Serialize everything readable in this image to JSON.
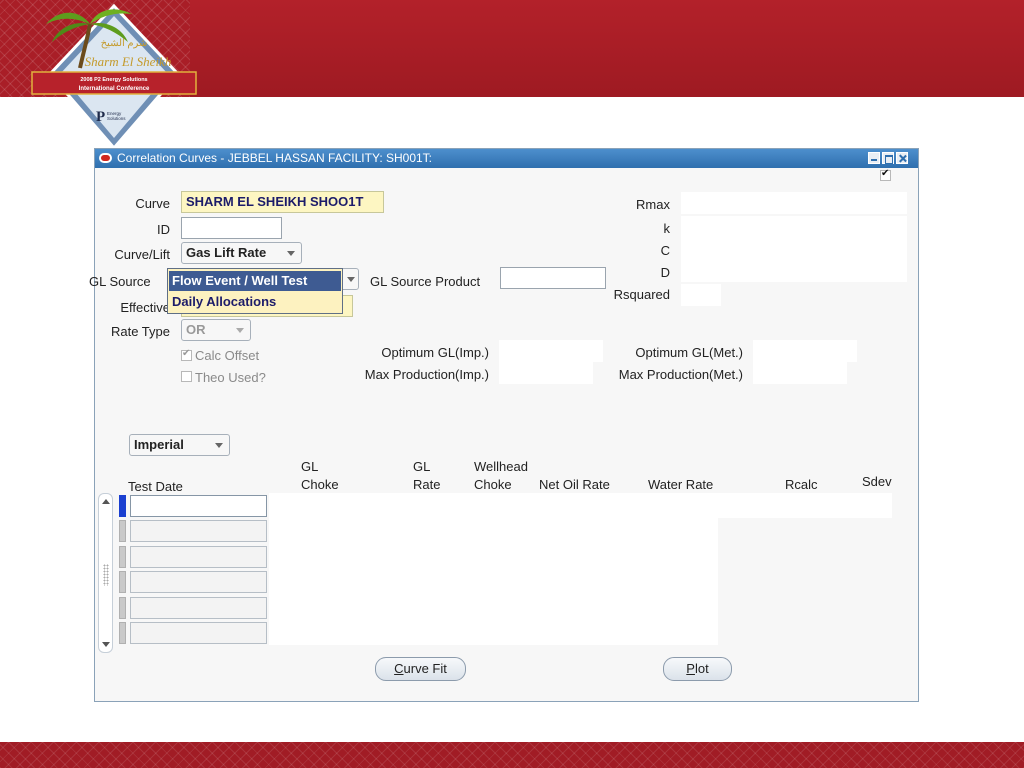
{
  "logo": {
    "arabic_text": "شرم الشيخ",
    "name": "Sharm El Sheikh",
    "conference_line1": "2008 P2 Energy Solutions",
    "conference_line2": "International Conference",
    "brand_mark": "P",
    "brand_line1": "Energy",
    "brand_line2": "Solutions"
  },
  "window": {
    "title": "Correlation Curves - JEBBEL HASSAN FACILITY: SH001T:"
  },
  "form": {
    "curve_label": "Curve",
    "curve_value": "SHARM EL SHEIKH SHOO1T",
    "id_label": "ID",
    "id_value": "",
    "curve_lift_label": "Curve/Lift",
    "curve_lift_value": "Gas Lift Rate",
    "gl_source_label": "GL Source",
    "gl_source_product_label": "GL Source Product",
    "gl_source_product_value": "",
    "effective_label": "Effective",
    "rate_type_label": "Rate Type",
    "rate_type_value": "OR",
    "calc_offset_label": "Calc Offset",
    "calc_offset_checked": true,
    "theo_used_label": "Theo Used?",
    "theo_used_checked": false,
    "rmax_label": "Rmax",
    "k_label": "k",
    "c_label": "C",
    "d_label": "D",
    "rsquared_label": "Rsquared",
    "optimum_gl_imp_label": "Optimum GL(Imp.)",
    "max_production_imp_label": "Max Production(Imp.)",
    "optimum_gl_met_label": "Optimum GL(Met.)",
    "max_production_met_label": "Max Production(Met.)",
    "top_right_checkbox_checked": true
  },
  "gl_source_dropdown": {
    "options": [
      "Flow Event / Well Test",
      "Daily Allocations"
    ],
    "selected_index": 0
  },
  "units": {
    "selected": "Imperial"
  },
  "table": {
    "columns": {
      "test_date": "Test Date",
      "gl_choke_1": "GL",
      "gl_choke_2": "Choke",
      "gl_rate_1": "GL",
      "gl_rate_2": "Rate",
      "wellhead_choke_1": "Wellhead",
      "wellhead_choke_2": "Choke",
      "net_oil_rate": "Net Oil Rate",
      "water_rate": "Water Rate",
      "rcalc": "Rcalc",
      "sdev": "Sdev"
    },
    "rows": [
      "",
      "",
      "",
      "",
      "",
      ""
    ]
  },
  "buttons": {
    "curve_fit_underline": "C",
    "curve_fit_rest": "urve Fit",
    "plot_underline": "P",
    "plot_rest": "lot"
  }
}
